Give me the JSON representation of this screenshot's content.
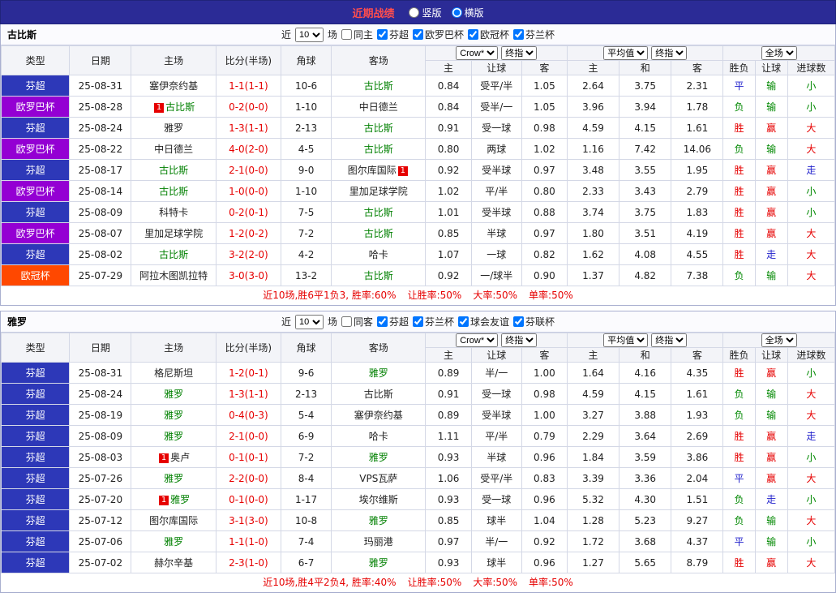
{
  "topbar": {
    "title": "近期战绩",
    "options": [
      {
        "label": "竖版",
        "selected": false
      },
      {
        "label": "横版",
        "selected": true
      }
    ]
  },
  "filter_labels": {
    "near": "近",
    "games": "场"
  },
  "columns": {
    "type": "类型",
    "date": "日期",
    "home": "主场",
    "score": "比分(半场)",
    "corner": "角球",
    "away": "客场",
    "asian": [
      "主",
      "让球",
      "客"
    ],
    "euro": [
      "主",
      "和",
      "客"
    ],
    "result": [
      "胜负",
      "让球",
      "进球数"
    ]
  },
  "selects": {
    "asian": [
      "Crow*",
      "终指"
    ],
    "euro": [
      "平均值",
      "终指"
    ],
    "result": [
      "全场"
    ]
  },
  "league_colors": {
    "芬超": "#2d38b8",
    "欧罗巴杯": "#9400d3",
    "欧冠杯": "#ff4800"
  },
  "result_colors": {
    "w": "#e60000",
    "l": "#008800",
    "d": "#2222cc"
  },
  "team_color": "#008000",
  "red_card_badge": "1",
  "sections": [
    {
      "team": "古比斯",
      "filter": {
        "count": "10",
        "same": {
          "label": "同主",
          "checked": false
        },
        "comps": [
          {
            "label": "芬超",
            "checked": true
          },
          {
            "label": "欧罗巴杯",
            "checked": true
          },
          {
            "label": "欧冠杯",
            "checked": true
          },
          {
            "label": "芬兰杯",
            "checked": true
          }
        ]
      },
      "rows": [
        {
          "lg": "芬超",
          "date": "25-08-31",
          "home": {
            "name": "塞伊奈约基",
            "team": false,
            "red": false
          },
          "score": "1-1(1-1)",
          "corner": "10-6",
          "away": {
            "name": "古比斯",
            "team": true,
            "red": false
          },
          "ah": [
            "0.84",
            "受平/半",
            "1.05"
          ],
          "eu": [
            "2.64",
            "3.75",
            "2.31"
          ],
          "res": [
            [
              "平",
              "d"
            ],
            [
              "输",
              "l"
            ],
            [
              "小",
              "l"
            ]
          ]
        },
        {
          "lg": "欧罗巴杯",
          "date": "25-08-28",
          "home": {
            "name": "古比斯",
            "team": true,
            "red": true
          },
          "score": "0-2(0-0)",
          "corner": "1-10",
          "away": {
            "name": "中日德兰",
            "team": false,
            "red": false
          },
          "ah": [
            "0.84",
            "受半/一",
            "1.05"
          ],
          "eu": [
            "3.96",
            "3.94",
            "1.78"
          ],
          "res": [
            [
              "负",
              "l"
            ],
            [
              "输",
              "l"
            ],
            [
              "小",
              "l"
            ]
          ]
        },
        {
          "lg": "芬超",
          "date": "25-08-24",
          "home": {
            "name": "雅罗",
            "team": false,
            "red": false
          },
          "score": "1-3(1-1)",
          "corner": "2-13",
          "away": {
            "name": "古比斯",
            "team": true,
            "red": false
          },
          "ah": [
            "0.91",
            "受一球",
            "0.98"
          ],
          "eu": [
            "4.59",
            "4.15",
            "1.61"
          ],
          "res": [
            [
              "胜",
              "w"
            ],
            [
              "赢",
              "w"
            ],
            [
              "大",
              "w"
            ]
          ]
        },
        {
          "lg": "欧罗巴杯",
          "date": "25-08-22",
          "home": {
            "name": "中日德兰",
            "team": false,
            "red": false
          },
          "score": "4-0(2-0)",
          "corner": "4-5",
          "away": {
            "name": "古比斯",
            "team": true,
            "red": false
          },
          "ah": [
            "0.80",
            "两球",
            "1.02"
          ],
          "eu": [
            "1.16",
            "7.42",
            "14.06"
          ],
          "res": [
            [
              "负",
              "l"
            ],
            [
              "输",
              "l"
            ],
            [
              "大",
              "w"
            ]
          ]
        },
        {
          "lg": "芬超",
          "date": "25-08-17",
          "home": {
            "name": "古比斯",
            "team": true,
            "red": false
          },
          "score": "2-1(0-0)",
          "corner": "9-0",
          "away": {
            "name": "图尔库国际",
            "team": false,
            "red": true
          },
          "ah": [
            "0.92",
            "受半球",
            "0.97"
          ],
          "eu": [
            "3.48",
            "3.55",
            "1.95"
          ],
          "res": [
            [
              "胜",
              "w"
            ],
            [
              "赢",
              "w"
            ],
            [
              "走",
              "d"
            ]
          ]
        },
        {
          "lg": "欧罗巴杯",
          "date": "25-08-14",
          "home": {
            "name": "古比斯",
            "team": true,
            "red": false
          },
          "score": "1-0(0-0)",
          "corner": "1-10",
          "away": {
            "name": "里加足球学院",
            "team": false,
            "red": false
          },
          "ah": [
            "1.02",
            "平/半",
            "0.80"
          ],
          "eu": [
            "2.33",
            "3.43",
            "2.79"
          ],
          "res": [
            [
              "胜",
              "w"
            ],
            [
              "赢",
              "w"
            ],
            [
              "小",
              "l"
            ]
          ]
        },
        {
          "lg": "芬超",
          "date": "25-08-09",
          "home": {
            "name": "科特卡",
            "team": false,
            "red": false
          },
          "score": "0-2(0-1)",
          "corner": "7-5",
          "away": {
            "name": "古比斯",
            "team": true,
            "red": false
          },
          "ah": [
            "1.01",
            "受半球",
            "0.88"
          ],
          "eu": [
            "3.74",
            "3.75",
            "1.83"
          ],
          "res": [
            [
              "胜",
              "w"
            ],
            [
              "赢",
              "w"
            ],
            [
              "小",
              "l"
            ]
          ]
        },
        {
          "lg": "欧罗巴杯",
          "date": "25-08-07",
          "home": {
            "name": "里加足球学院",
            "team": false,
            "red": false
          },
          "score": "1-2(0-2)",
          "corner": "7-2",
          "away": {
            "name": "古比斯",
            "team": true,
            "red": false
          },
          "ah": [
            "0.85",
            "半球",
            "0.97"
          ],
          "eu": [
            "1.80",
            "3.51",
            "4.19"
          ],
          "res": [
            [
              "胜",
              "w"
            ],
            [
              "赢",
              "w"
            ],
            [
              "大",
              "w"
            ]
          ]
        },
        {
          "lg": "芬超",
          "date": "25-08-02",
          "home": {
            "name": "古比斯",
            "team": true,
            "red": false
          },
          "score": "3-2(2-0)",
          "corner": "4-2",
          "away": {
            "name": "哈卡",
            "team": false,
            "red": false
          },
          "ah": [
            "1.07",
            "一球",
            "0.82"
          ],
          "eu": [
            "1.62",
            "4.08",
            "4.55"
          ],
          "res": [
            [
              "胜",
              "w"
            ],
            [
              "走",
              "d"
            ],
            [
              "大",
              "w"
            ]
          ]
        },
        {
          "lg": "欧冠杯",
          "date": "25-07-29",
          "home": {
            "name": "阿拉木图凯拉特",
            "team": false,
            "red": false
          },
          "score": "3-0(3-0)",
          "corner": "13-2",
          "away": {
            "name": "古比斯",
            "team": true,
            "red": false
          },
          "ah": [
            "0.92",
            "一/球半",
            "0.90"
          ],
          "eu": [
            "1.37",
            "4.82",
            "7.38"
          ],
          "res": [
            [
              "负",
              "l"
            ],
            [
              "输",
              "l"
            ],
            [
              "大",
              "w"
            ]
          ]
        }
      ],
      "summary": [
        "近10场,胜6平1负3, 胜率:60%",
        "让胜率:50%",
        "大率:50%",
        "单率:50%"
      ]
    },
    {
      "team": "雅罗",
      "filter": {
        "count": "10",
        "same": {
          "label": "同客",
          "checked": false
        },
        "comps": [
          {
            "label": "芬超",
            "checked": true
          },
          {
            "label": "芬兰杯",
            "checked": true
          },
          {
            "label": "球会友谊",
            "checked": true
          },
          {
            "label": "芬联杯",
            "checked": true
          }
        ]
      },
      "rows": [
        {
          "lg": "芬超",
          "date": "25-08-31",
          "home": {
            "name": "格尼斯坦",
            "team": false,
            "red": false
          },
          "score": "1-2(0-1)",
          "corner": "9-6",
          "away": {
            "name": "雅罗",
            "team": true,
            "red": false
          },
          "ah": [
            "0.89",
            "半/一",
            "1.00"
          ],
          "eu": [
            "1.64",
            "4.16",
            "4.35"
          ],
          "res": [
            [
              "胜",
              "w"
            ],
            [
              "赢",
              "w"
            ],
            [
              "小",
              "l"
            ]
          ]
        },
        {
          "lg": "芬超",
          "date": "25-08-24",
          "home": {
            "name": "雅罗",
            "team": true,
            "red": false
          },
          "score": "1-3(1-1)",
          "corner": "2-13",
          "away": {
            "name": "古比斯",
            "team": false,
            "red": false
          },
          "ah": [
            "0.91",
            "受一球",
            "0.98"
          ],
          "eu": [
            "4.59",
            "4.15",
            "1.61"
          ],
          "res": [
            [
              "负",
              "l"
            ],
            [
              "输",
              "l"
            ],
            [
              "大",
              "w"
            ]
          ]
        },
        {
          "lg": "芬超",
          "date": "25-08-19",
          "home": {
            "name": "雅罗",
            "team": true,
            "red": false
          },
          "score": "0-4(0-3)",
          "corner": "5-4",
          "away": {
            "name": "塞伊奈约基",
            "team": false,
            "red": false
          },
          "ah": [
            "0.89",
            "受半球",
            "1.00"
          ],
          "eu": [
            "3.27",
            "3.88",
            "1.93"
          ],
          "res": [
            [
              "负",
              "l"
            ],
            [
              "输",
              "l"
            ],
            [
              "大",
              "w"
            ]
          ]
        },
        {
          "lg": "芬超",
          "date": "25-08-09",
          "home": {
            "name": "雅罗",
            "team": true,
            "red": false
          },
          "score": "2-1(0-0)",
          "corner": "6-9",
          "away": {
            "name": "哈卡",
            "team": false,
            "red": false
          },
          "ah": [
            "1.11",
            "平/半",
            "0.79"
          ],
          "eu": [
            "2.29",
            "3.64",
            "2.69"
          ],
          "res": [
            [
              "胜",
              "w"
            ],
            [
              "赢",
              "w"
            ],
            [
              "走",
              "d"
            ]
          ]
        },
        {
          "lg": "芬超",
          "date": "25-08-03",
          "home": {
            "name": "奥卢",
            "team": false,
            "red": true
          },
          "score": "0-1(0-1)",
          "corner": "7-2",
          "away": {
            "name": "雅罗",
            "team": true,
            "red": false
          },
          "ah": [
            "0.93",
            "半球",
            "0.96"
          ],
          "eu": [
            "1.84",
            "3.59",
            "3.86"
          ],
          "res": [
            [
              "胜",
              "w"
            ],
            [
              "赢",
              "w"
            ],
            [
              "小",
              "l"
            ]
          ]
        },
        {
          "lg": "芬超",
          "date": "25-07-26",
          "home": {
            "name": "雅罗",
            "team": true,
            "red": false
          },
          "score": "2-2(0-0)",
          "corner": "8-4",
          "away": {
            "name": "VPS瓦萨",
            "team": false,
            "red": false
          },
          "ah": [
            "1.06",
            "受平/半",
            "0.83"
          ],
          "eu": [
            "3.39",
            "3.36",
            "2.04"
          ],
          "res": [
            [
              "平",
              "d"
            ],
            [
              "赢",
              "w"
            ],
            [
              "大",
              "w"
            ]
          ]
        },
        {
          "lg": "芬超",
          "date": "25-07-20",
          "home": {
            "name": "雅罗",
            "team": true,
            "red": true
          },
          "score": "0-1(0-0)",
          "corner": "1-17",
          "away": {
            "name": "埃尔维斯",
            "team": false,
            "red": false
          },
          "ah": [
            "0.93",
            "受一球",
            "0.96"
          ],
          "eu": [
            "5.32",
            "4.30",
            "1.51"
          ],
          "res": [
            [
              "负",
              "l"
            ],
            [
              "走",
              "d"
            ],
            [
              "小",
              "l"
            ]
          ]
        },
        {
          "lg": "芬超",
          "date": "25-07-12",
          "home": {
            "name": "图尔库国际",
            "team": false,
            "red": false
          },
          "score": "3-1(3-0)",
          "corner": "10-8",
          "away": {
            "name": "雅罗",
            "team": true,
            "red": false
          },
          "ah": [
            "0.85",
            "球半",
            "1.04"
          ],
          "eu": [
            "1.28",
            "5.23",
            "9.27"
          ],
          "res": [
            [
              "负",
              "l"
            ],
            [
              "输",
              "l"
            ],
            [
              "大",
              "w"
            ]
          ]
        },
        {
          "lg": "芬超",
          "date": "25-07-06",
          "home": {
            "name": "雅罗",
            "team": true,
            "red": false
          },
          "score": "1-1(1-0)",
          "corner": "7-4",
          "away": {
            "name": "玛丽港",
            "team": false,
            "red": false
          },
          "ah": [
            "0.97",
            "半/一",
            "0.92"
          ],
          "eu": [
            "1.72",
            "3.68",
            "4.37"
          ],
          "res": [
            [
              "平",
              "d"
            ],
            [
              "输",
              "l"
            ],
            [
              "小",
              "l"
            ]
          ]
        },
        {
          "lg": "芬超",
          "date": "25-07-02",
          "home": {
            "name": "赫尔辛基",
            "team": false,
            "red": false
          },
          "score": "2-3(1-0)",
          "corner": "6-7",
          "away": {
            "name": "雅罗",
            "team": true,
            "red": false
          },
          "ah": [
            "0.93",
            "球半",
            "0.96"
          ],
          "eu": [
            "1.27",
            "5.65",
            "8.79"
          ],
          "res": [
            [
              "胜",
              "w"
            ],
            [
              "赢",
              "w"
            ],
            [
              "大",
              "w"
            ]
          ]
        }
      ],
      "summary": [
        "近10场,胜4平2负4, 胜率:40%",
        "让胜率:50%",
        "大率:50%",
        "单率:50%"
      ]
    }
  ]
}
